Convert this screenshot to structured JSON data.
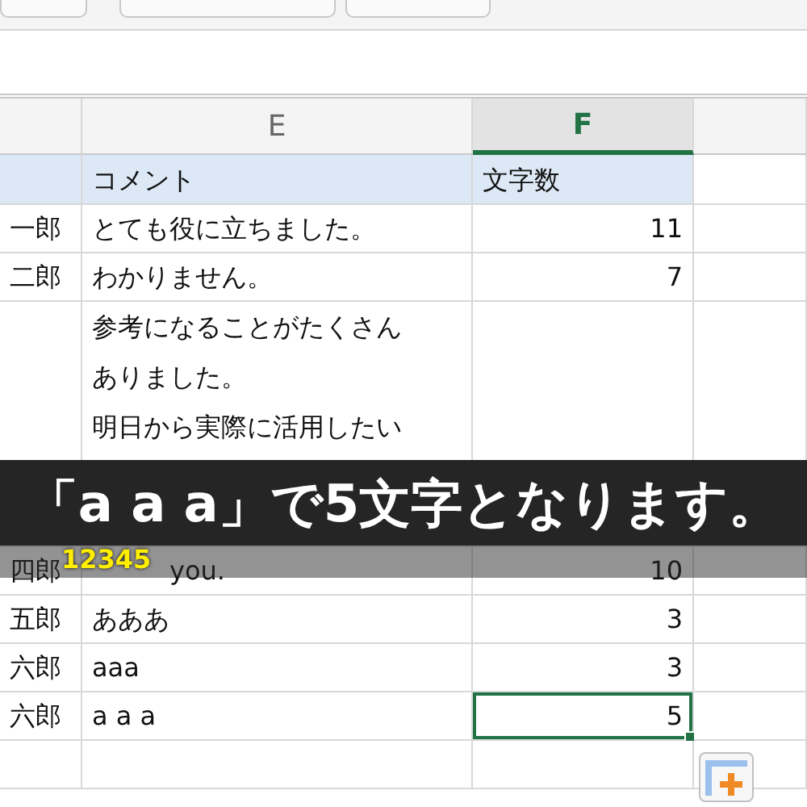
{
  "columns": [
    {
      "label": "E",
      "selected": false
    },
    {
      "label": "F",
      "selected": true
    }
  ],
  "rows": [
    {
      "kind": "header",
      "comment": [
        "コメント"
      ],
      "count": "文字数",
      "selected": false
    },
    {
      "kind": "data",
      "name": "一郎",
      "comment": [
        "とても役に立ちました。"
      ],
      "count": "11",
      "selected": false
    },
    {
      "kind": "data",
      "name": "二郎",
      "comment": [
        "わかりません。"
      ],
      "count": "7",
      "selected": false
    },
    {
      "kind": "tall",
      "comment": [
        "参考になることがたくさん",
        "ありました。",
        "明日から実際に活用したい"
      ],
      "selected": false
    },
    {
      "kind": "data",
      "name": "四郎",
      "comment": [
        "you."
      ],
      "count": "10",
      "selected": false
    },
    {
      "kind": "data",
      "name": "五郎",
      "comment": [
        "あああ"
      ],
      "count": "3",
      "selected": false
    },
    {
      "kind": "data",
      "name": "六郎",
      "comment": [
        "aaa"
      ],
      "count": "3",
      "selected": false
    },
    {
      "kind": "data",
      "name": "六郎",
      "comment": [
        "a a a"
      ],
      "count": "5",
      "selected": true
    },
    {
      "kind": "empty",
      "selected": false
    }
  ],
  "caption": {
    "text": "「a a a」で5文字となります。",
    "digits": "12345"
  }
}
